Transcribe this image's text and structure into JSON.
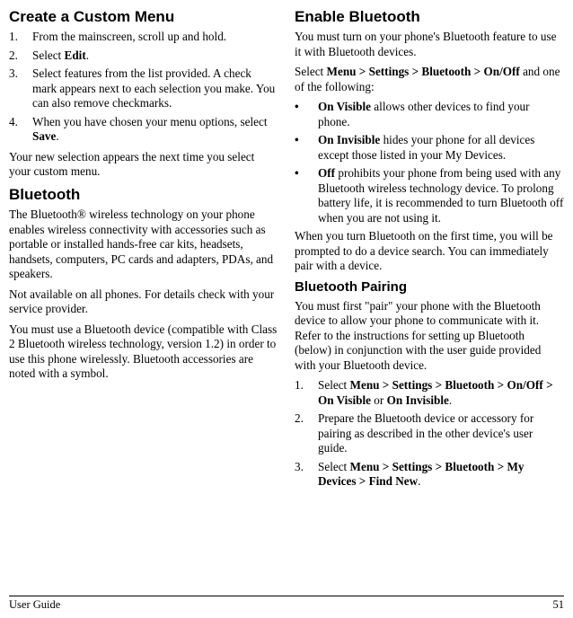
{
  "left": {
    "h1": "Create a Custom Menu",
    "steps": [
      {
        "num": "1.",
        "txt": "From the mainscreen, scroll up and hold."
      },
      {
        "num": "2.",
        "txt": "Select ",
        "bold": "Edit",
        "after": "."
      },
      {
        "num": "3.",
        "txt": "Select features from the list provided. A check mark appears next to each selection you make. You can also remove checkmarks."
      },
      {
        "num": "4.",
        "txt": "When you have chosen your menu options, select ",
        "bold": "Save",
        "after": "."
      }
    ],
    "p1": "Your new selection appears the next time you select your custom menu.",
    "h2": "Bluetooth",
    "p2": "The Bluetooth® wireless technology on your phone enables wireless connectivity with accessories such as portable or installed hands-free car kits, headsets, handsets, computers, PC cards and adapters, PDAs, and speakers.",
    "p3": "Not available on all phones. For details check with your service provider.",
    "p4": "You must use a Bluetooth device (compatible with Class 2 Bluetooth wireless technology, version 1.2) in order to use this phone wirelessly. Bluetooth accessories are noted with a symbol."
  },
  "right": {
    "h1": "Enable Bluetooth",
    "p1": "You must turn on your phone's Bluetooth feature to use it with Bluetooth devices.",
    "p2a": "Select ",
    "p2b": "Menu > Settings > Bluetooth > On/Off",
    "p2c": " and one of the following:",
    "bullets": [
      {
        "bold": "On Visible",
        "txt": " allows other devices to find your phone."
      },
      {
        "bold": "On Invisible",
        "txt": " hides your phone for all devices except those listed in your My Devices."
      },
      {
        "bold": "Off",
        "txt": " prohibits your phone from being used with any Bluetooth wireless technology device. To prolong battery life, it is recommended to turn Bluetooth off when you are not using it."
      }
    ],
    "p3": "When you turn Bluetooth on the first time, you will be prompted to do a device search. You can immediately pair with a device.",
    "h2": "Bluetooth Pairing",
    "p4": "You must first \"pair\" your phone with the Bluetooth device to allow your phone to communicate with it. Refer to the instructions for setting up Bluetooth (below) in conjunction with the user guide provided with your Bluetooth device.",
    "steps": [
      {
        "num": "1.",
        "pre": "Select ",
        "bold": "Menu > Settings > Bluetooth > On/Off > On Visible",
        "mid": " or ",
        "bold2": "On Invisible",
        "after": "."
      },
      {
        "num": "2.",
        "txt": "Prepare the Bluetooth device or accessory for pairing as described in the other device's user guide."
      },
      {
        "num": "3.",
        "pre": "Select ",
        "bold": "Menu > Settings > Bluetooth > My Devices > Find New",
        "after": "."
      }
    ]
  },
  "footer": {
    "left": "User Guide",
    "right": "51"
  }
}
